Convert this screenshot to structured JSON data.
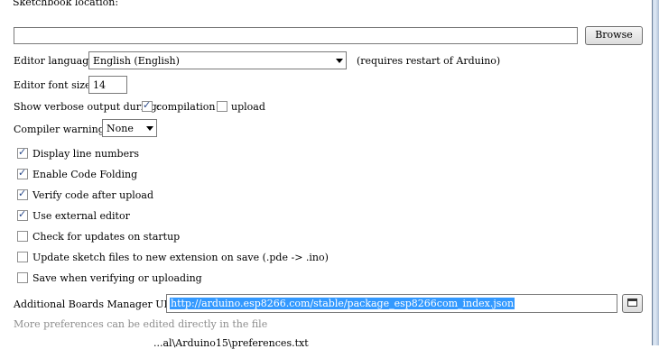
{
  "sketchbook": {
    "label": "Sketchbook location:",
    "path": "",
    "browse_label": "Browse"
  },
  "editor_language": {
    "label": "Editor language:",
    "value": "English (English)",
    "note": "(requires restart of Arduino)"
  },
  "font_size": {
    "label": "Editor font size:",
    "value": "14"
  },
  "verbose": {
    "label": "Show verbose output during:",
    "compilation_label": "compilation",
    "compilation_checked": true,
    "upload_label": "upload",
    "upload_checked": false
  },
  "compiler_warnings": {
    "label": "Compiler warnings:",
    "value": "None"
  },
  "options": [
    {
      "label": "Display line numbers",
      "checked": true
    },
    {
      "label": "Enable Code Folding",
      "checked": true
    },
    {
      "label": "Verify code after upload",
      "checked": true
    },
    {
      "label": "Use external editor",
      "checked": true
    },
    {
      "label": "Check for updates on startup",
      "checked": false
    },
    {
      "label": "Update sketch files to new extension on save (.pde -> .ino)",
      "checked": false
    },
    {
      "label": "Save when verifying or uploading",
      "checked": false
    }
  ],
  "boards_manager": {
    "label": "Additional Boards Manager URLs:",
    "url": "http://arduino.esp8266.com/stable/package_esp8266com_index.json"
  },
  "footer": {
    "more_prefs": "More preferences can be edited directly in the file",
    "prefs_path": "...al\\Arduino15\\preferences.txt"
  }
}
